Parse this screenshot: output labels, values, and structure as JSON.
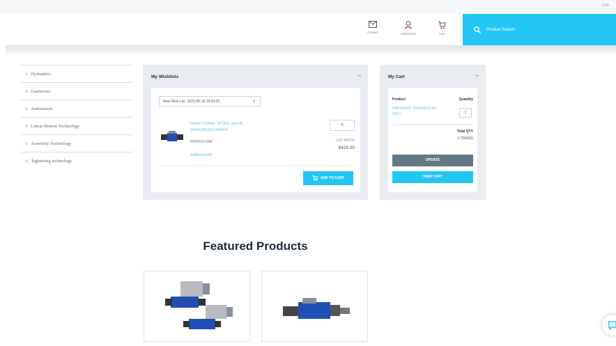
{
  "topbar": {
    "region": "USA"
  },
  "header": {
    "contact_label": "Contact",
    "myaccount_label": "myRexroth",
    "cart_label": "Cart",
    "search_label": "Product Search"
  },
  "sidebar": {
    "items": [
      {
        "label": "Hydraulics"
      },
      {
        "label": "Gearboxes"
      },
      {
        "label": "Automation"
      },
      {
        "label": "Linear Motion Technology"
      },
      {
        "label": "Assembly Technology"
      },
      {
        "label": "Tightening technology"
      }
    ]
  },
  "wishlist": {
    "title": "My Wishlists",
    "minimize": "–",
    "selected_list": "New Wish List -2022-06-18 19:03:05",
    "product": {
      "name": "DIRECTIONAL SPOOL VALVE 4WE6J6X/EG24N9K4",
      "sku": "R900561288",
      "info_link": "Additional Info",
      "quantity": "0",
      "list_price_label": "LIST PRICE",
      "list_price": "$429.00"
    },
    "add_to_cart": "ADD TO CART"
  },
  "cart": {
    "title": "My Cart",
    "minimize": "–",
    "col_product": "Product",
    "col_quantity": "Quantity",
    "product_name": "PRESSURE TRANSDUCER HM 2...",
    "quantity": "1",
    "total_label": "Total QTY",
    "total_value": "1 ITEM(S)",
    "update": "UPDATE",
    "view_cart": "VIEW CART"
  },
  "featured": {
    "title": "Featured Products"
  },
  "colors": {
    "accent": "#24c6f3",
    "panel": "#e9edf1",
    "update": "#647886"
  }
}
